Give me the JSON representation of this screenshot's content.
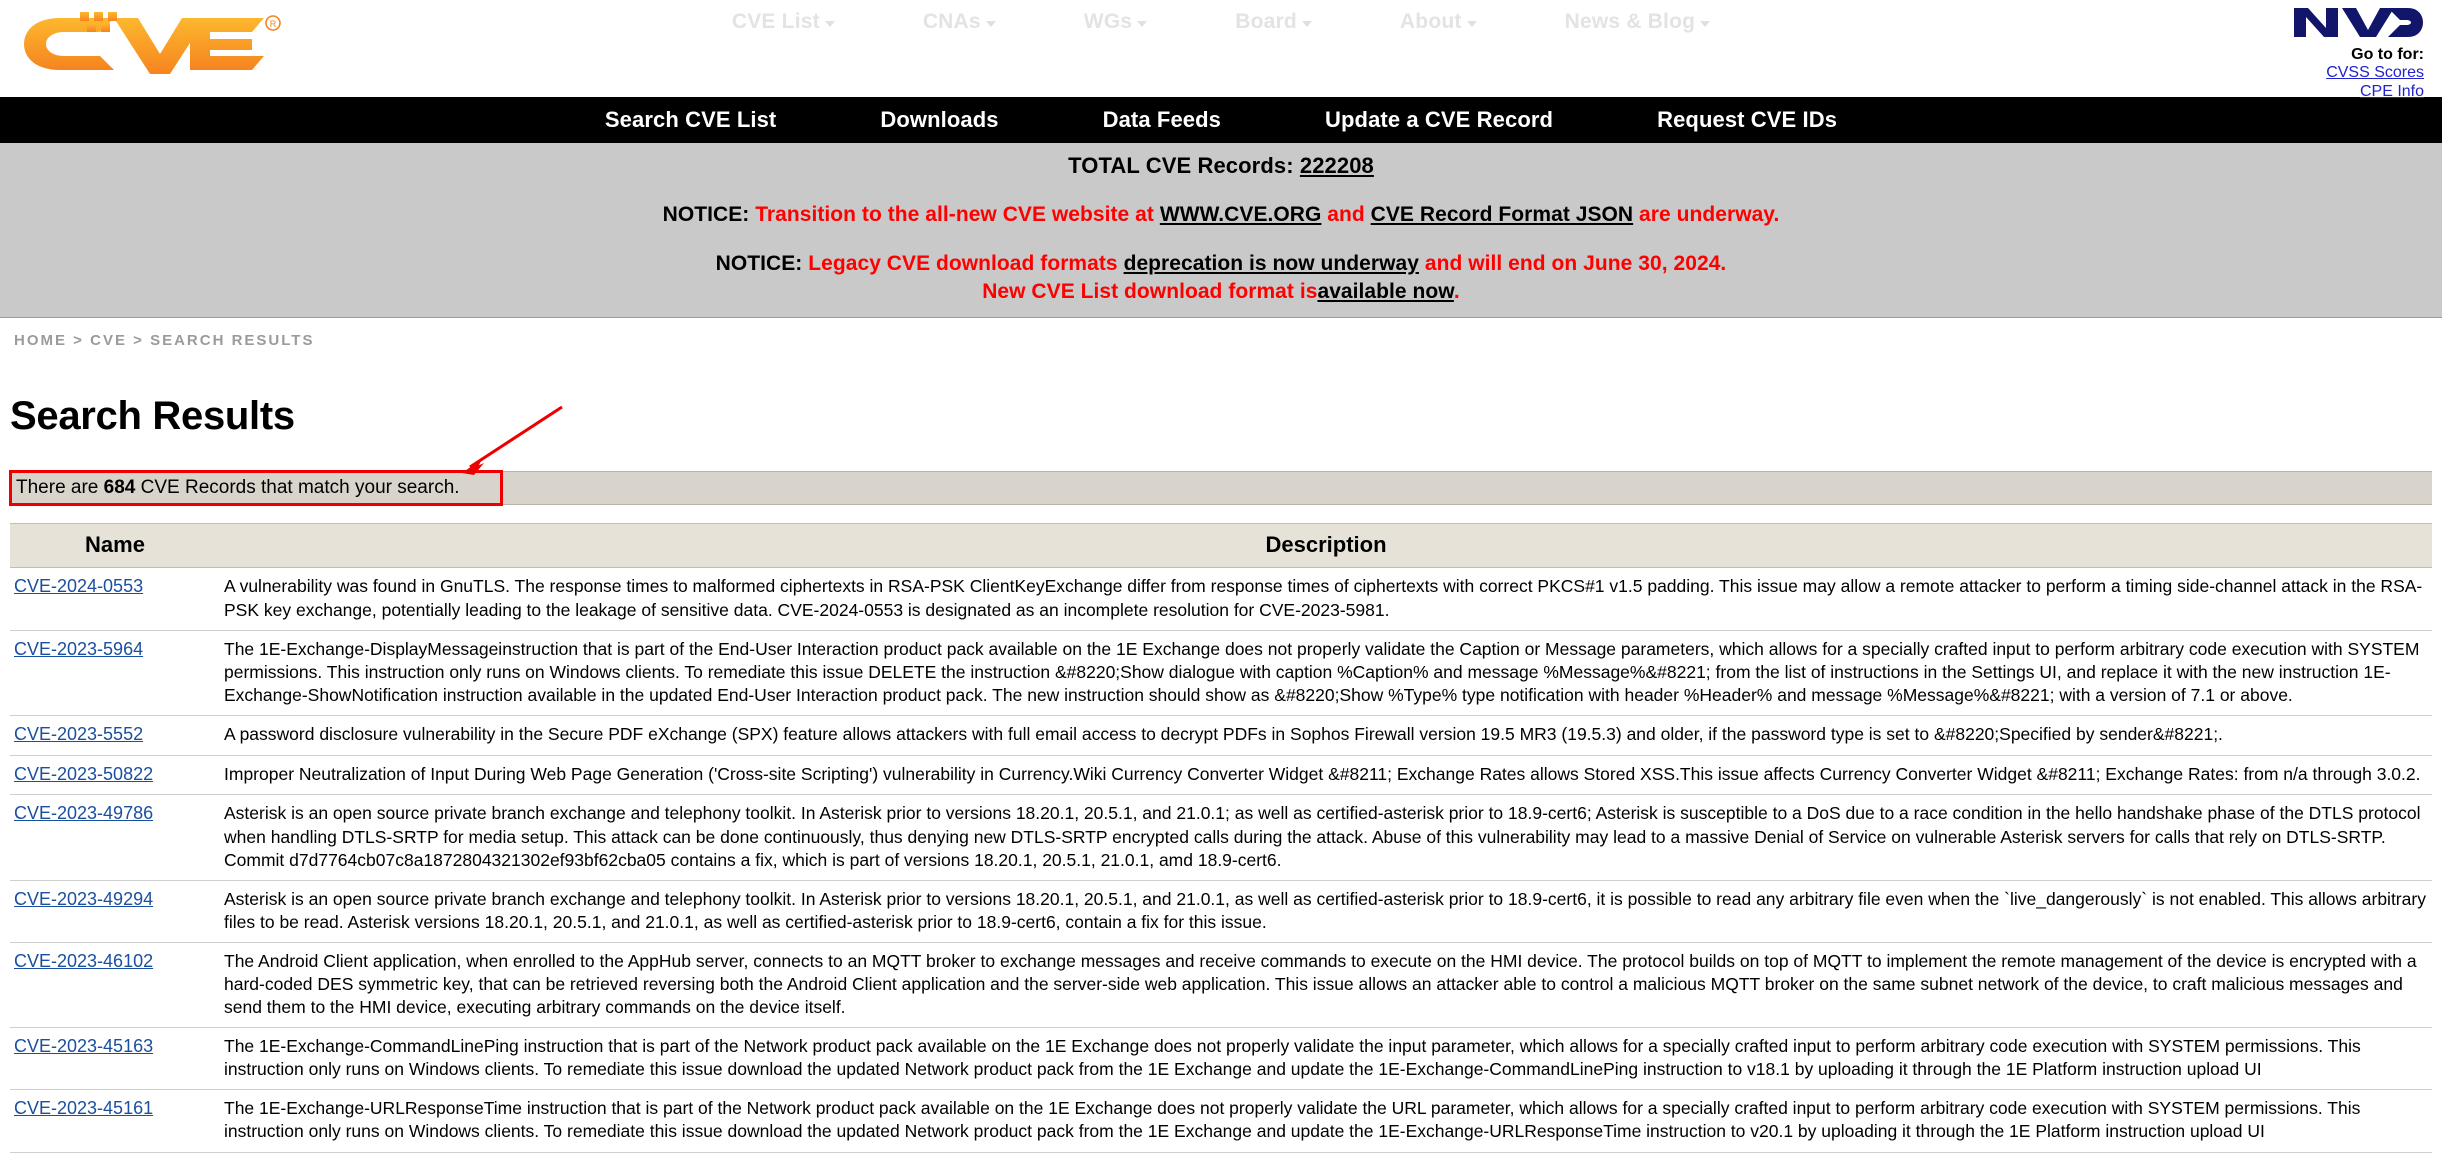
{
  "header": {
    "logo_alt": "CVE",
    "nav": [
      {
        "label": "CVE List",
        "has_caret": true,
        "icon": "chevron-down-icon"
      },
      {
        "label": "CNAs",
        "has_caret": true,
        "icon": "chevron-down-icon"
      },
      {
        "label": "WGs",
        "has_caret": true,
        "icon": "chevron-down-icon"
      },
      {
        "label": "Board",
        "has_caret": true,
        "icon": "chevron-down-icon"
      },
      {
        "label": "About",
        "has_caret": true,
        "icon": "chevron-down-icon"
      },
      {
        "label": "News & Blog",
        "has_caret": true,
        "icon": "chevron-down-icon"
      }
    ],
    "nvd": {
      "logo_text": "NVD",
      "goto_label": "Go to for:",
      "links": [
        "CVSS Scores",
        "CPE Info"
      ]
    }
  },
  "black_nav": [
    "Search CVE List",
    "Downloads",
    "Data Feeds",
    "Update a CVE Record",
    "Request CVE IDs"
  ],
  "notices": {
    "total_label": "TOTAL CVE Records:",
    "total_count": "222208",
    "notice1": {
      "label": "NOTICE:",
      "part1": "Transition to the all-new CVE website at",
      "link1": "WWW.CVE.ORG",
      "part2": "and",
      "link2": "CVE Record Format JSON",
      "part3": "are underway."
    },
    "notice2": {
      "label": "NOTICE:",
      "part1": "Legacy CVE download formats",
      "link1": "deprecation is now underway",
      "part2": "and will end on June 30, 2024."
    },
    "notice3": {
      "part1": "New CVE List download format is",
      "link1": "available now",
      "part2": "."
    }
  },
  "breadcrumb": {
    "items": [
      "HOME",
      "CVE",
      "SEARCH RESULTS"
    ],
    "separator": ">"
  },
  "page": {
    "title": "Search Results",
    "result_prefix": "There are",
    "result_count": "684",
    "result_suffix": "CVE Records that match your search."
  },
  "table": {
    "headers": {
      "name": "Name",
      "description": "Description"
    },
    "rows": [
      {
        "name": "CVE-2024-0553",
        "description": "A vulnerability was found in GnuTLS. The response times to malformed ciphertexts in RSA-PSK ClientKeyExchange differ from response times of ciphertexts with correct PKCS#1 v1.5 padding. This issue may allow a remote attacker to perform a timing side-channel attack in the RSA-PSK key exchange, potentially leading to the leakage of sensitive data. CVE-2024-0553 is designated as an incomplete resolution for CVE-2023-5981."
      },
      {
        "name": "CVE-2023-5964",
        "description": "The 1E-Exchange-DisplayMessageinstruction that is part of the End-User Interaction product pack available on the 1E Exchange does not properly validate the Caption or Message parameters, which allows for a specially crafted input to perform arbitrary code execution with SYSTEM permissions. This instruction only runs on Windows clients. To remediate this issue DELETE the instruction &#8220;Show dialogue with caption %Caption% and message %Message%&#8221; from the list of instructions in the Settings UI, and replace it with the new instruction 1E-Exchange-ShowNotification instruction available in the updated End-User Interaction product pack. The new instruction should show as &#8220;Show %Type% type notification with header %Header% and message %Message%&#8221; with a version of 7.1 or above."
      },
      {
        "name": "CVE-2023-5552",
        "description": "A password disclosure vulnerability in the Secure PDF eXchange (SPX) feature allows attackers with full email access to decrypt PDFs in Sophos Firewall version 19.5 MR3 (19.5.3) and older, if the password type is set to &#8220;Specified by sender&#8221;."
      },
      {
        "name": "CVE-2023-50822",
        "description": "Improper Neutralization of Input During Web Page Generation ('Cross-site Scripting') vulnerability in Currency.Wiki Currency Converter Widget &#8211; Exchange Rates allows Stored XSS.This issue affects Currency Converter Widget &#8211; Exchange Rates: from n/a through 3.0.2."
      },
      {
        "name": "CVE-2023-49786",
        "description": "Asterisk is an open source private branch exchange and telephony toolkit. In Asterisk prior to versions 18.20.1, 20.5.1, and 21.0.1; as well as certified-asterisk prior to 18.9-cert6; Asterisk is susceptible to a DoS due to a race condition in the hello handshake phase of the DTLS protocol when handling DTLS-SRTP for media setup. This attack can be done continuously, thus denying new DTLS-SRTP encrypted calls during the attack. Abuse of this vulnerability may lead to a massive Denial of Service on vulnerable Asterisk servers for calls that rely on DTLS-SRTP. Commit d7d7764cb07c8a1872804321302ef93bf62cba05 contains a fix, which is part of versions 18.20.1, 20.5.1, 21.0.1, amd 18.9-cert6."
      },
      {
        "name": "CVE-2023-49294",
        "description": "Asterisk is an open source private branch exchange and telephony toolkit. In Asterisk prior to versions 18.20.1, 20.5.1, and 21.0.1, as well as certified-asterisk prior to 18.9-cert6, it is possible to read any arbitrary file even when the `live_dangerously` is not enabled. This allows arbitrary files to be read. Asterisk versions 18.20.1, 20.5.1, and 21.0.1, as well as certified-asterisk prior to 18.9-cert6, contain a fix for this issue."
      },
      {
        "name": "CVE-2023-46102",
        "description": "The Android Client application, when enrolled to the AppHub server, connects to an MQTT broker to exchange messages and receive commands to execute on the HMI device. The protocol builds on top of MQTT to implement the remote management of the device is encrypted with a hard-coded DES symmetric key, that can be retrieved reversing both the Android Client application and the server-side web application. This issue allows an attacker able to control a malicious MQTT broker on the same subnet network of the device, to craft malicious messages and send them to the HMI device, executing arbitrary commands on the device itself."
      },
      {
        "name": "CVE-2023-45163",
        "description": "The 1E-Exchange-CommandLinePing instruction that is part of the Network product pack available on the 1E Exchange does not properly validate the input parameter, which allows for a specially crafted input to perform arbitrary code execution with SYSTEM permissions. This instruction only runs on Windows clients. To remediate this issue download the updated Network product pack from the 1E Exchange and update the 1E-Exchange-CommandLinePing instruction to v18.1 by uploading it through the 1E Platform instruction upload UI"
      },
      {
        "name": "CVE-2023-45161",
        "description": "The 1E-Exchange-URLResponseTime instruction that is part of the Network product pack available on the 1E Exchange does not properly validate the URL parameter, which allows for a specially crafted input to perform arbitrary code execution with SYSTEM permissions. This instruction only runs on Windows clients. To remediate this issue download the updated Network product pack from the 1E Exchange and update the 1E-Exchange-URLResponseTime instruction to v20.1 by uploading it through the 1E Platform instruction upload UI"
      }
    ]
  },
  "colors": {
    "cve_orange": "#f8a01c",
    "notice_red": "#ff0000",
    "link_blue": "#1a4fa0",
    "nvd_navy": "#12166b",
    "annotation_red": "#ee0000"
  }
}
